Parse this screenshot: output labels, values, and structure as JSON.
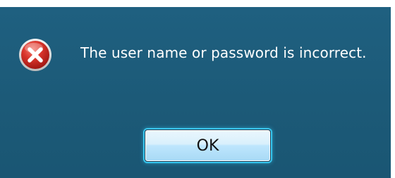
{
  "dialog": {
    "icon": "error-icon",
    "message": "The user name or password is incorrect.",
    "ok_label": "OK"
  },
  "colors": {
    "background": "#1d5a78",
    "message_text": "#ffffff",
    "icon_red": "#c8211d",
    "button_glow": "#39c7ef"
  }
}
